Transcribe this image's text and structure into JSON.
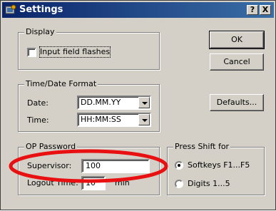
{
  "title": "Settings",
  "title_buttons": {
    "help": "?",
    "close": "X"
  },
  "display": {
    "legend": "Display",
    "checkbox_label": "Input field flashes",
    "checked": false
  },
  "time_date": {
    "legend": "Time/Date Format",
    "date_label": "Date:",
    "date_value": "DD.MM.YY",
    "time_label": "Time:",
    "time_value": "HH:MM:SS"
  },
  "op_password": {
    "legend": "OP Password",
    "supervisor_label": "Supervisor:",
    "supervisor_value": "100",
    "logout_label": "Logout Time:",
    "logout_value": "10",
    "logout_unit": "min"
  },
  "press_shift": {
    "legend": "Press Shift for",
    "options": [
      {
        "label": "Softkeys F1...F5",
        "selected": true
      },
      {
        "label": "Digits 1...5",
        "selected": false
      }
    ]
  },
  "buttons": {
    "ok": "OK",
    "cancel": "Cancel",
    "defaults": "Defaults..."
  },
  "colors": {
    "titlebar_start": "#0a246a",
    "titlebar_end": "#3a6ea5",
    "annotation_ellipse": "#e81010",
    "dialog_face": "#d4d0c8"
  }
}
